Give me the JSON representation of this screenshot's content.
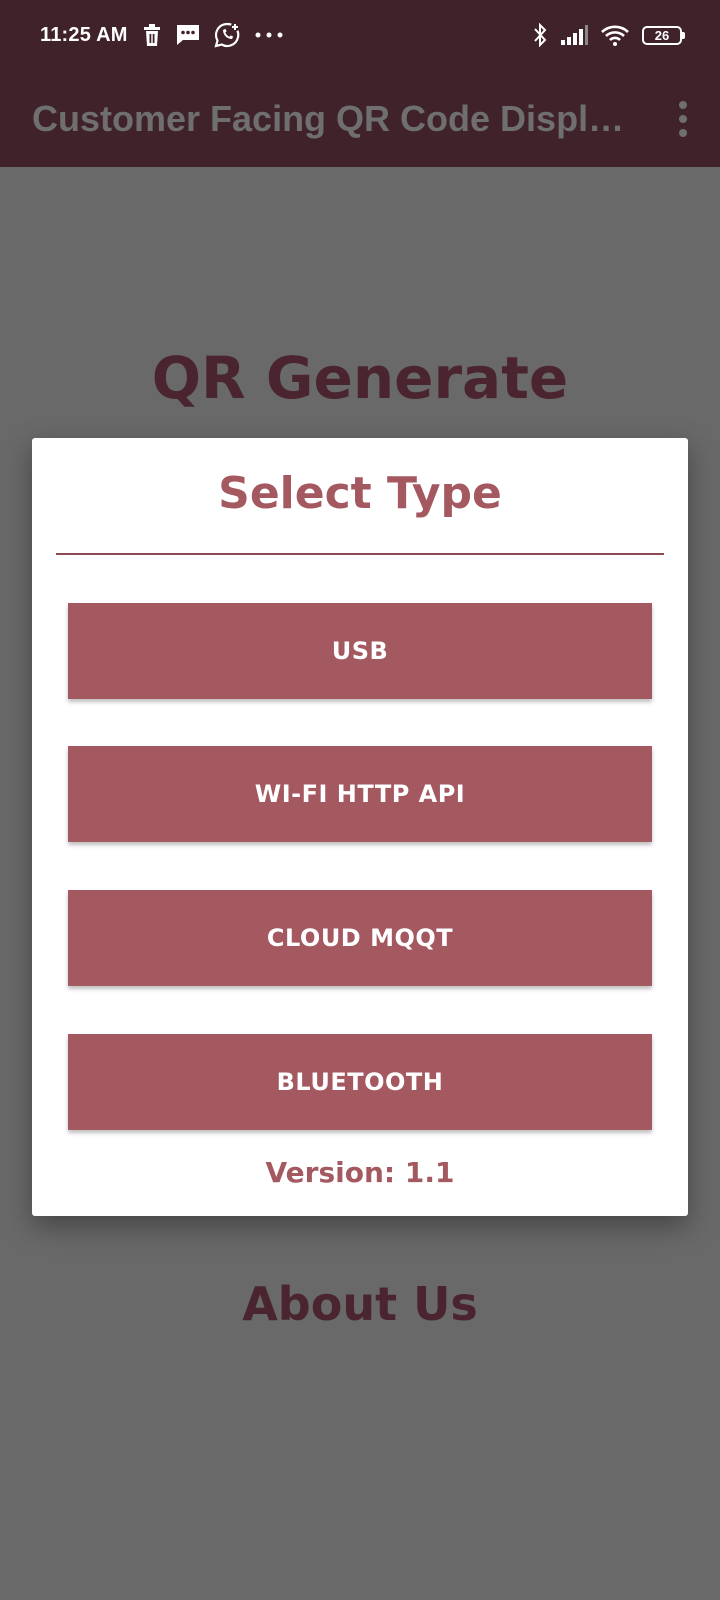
{
  "status_bar": {
    "time": "11:25 AM",
    "notification_icons": [
      "trash-icon",
      "message-icon",
      "whatsapp-icon",
      "more-notifications-icon"
    ],
    "system_icons": [
      "bluetooth-icon",
      "signal-icon",
      "wifi-icon",
      "battery-icon"
    ],
    "battery_level": "26"
  },
  "app_bar": {
    "title": "Customer Facing QR Code Display",
    "menu_icon": "more-vert-icon"
  },
  "background": {
    "qr_heading": "QR Generate",
    "about_heading": "About Us"
  },
  "dialog": {
    "title": "Select Type",
    "buttons": [
      {
        "label": "USB"
      },
      {
        "label": "WI-FI HTTP API"
      },
      {
        "label": "CLOUD MQQT"
      },
      {
        "label": "BLUETOOTH"
      }
    ],
    "version": "Version: 1.1"
  },
  "colors": {
    "app_bar_bg": "#40222a",
    "overlay_bg": "#696969",
    "accent": "#a45860",
    "heading_dark": "#4a2530",
    "dialog_bg": "#ffffff"
  }
}
